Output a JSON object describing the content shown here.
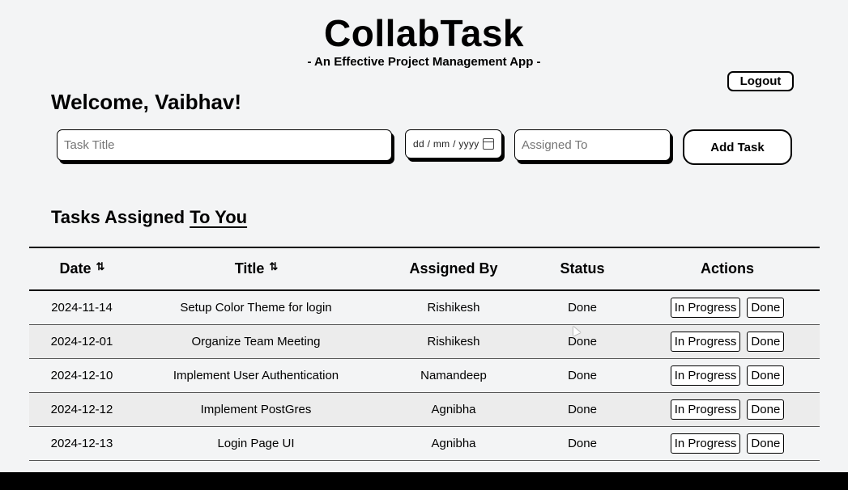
{
  "header": {
    "app_name": "CollabTask",
    "tagline": "- An Effective Project Management App -",
    "logout_label": "Logout"
  },
  "welcome_text": "Welcome, Vaibhav!",
  "form": {
    "title_placeholder": "Task Title",
    "date_placeholder": "dd / mm / yyyy",
    "assignee_placeholder": "Assigned To",
    "add_label": "Add Task"
  },
  "section": {
    "prefix": "Tasks Assigned ",
    "emphasis": "To You"
  },
  "table": {
    "headers": {
      "date": "Date",
      "title": "Title",
      "assigned_by": "Assigned By",
      "status": "Status",
      "actions": "Actions"
    },
    "sort_icon": "sort-arrows-icon",
    "sort_glyph": "⇅",
    "action_labels": {
      "in_progress": "In Progress",
      "done": "Done"
    },
    "rows": [
      {
        "date": "2024-11-14",
        "title": "Setup Color Theme for login",
        "assigned_by": "Rishikesh",
        "status": "Done"
      },
      {
        "date": "2024-12-01",
        "title": "Organize Team Meeting",
        "assigned_by": "Rishikesh",
        "status": "Done"
      },
      {
        "date": "2024-12-10",
        "title": "Implement User Authentication",
        "assigned_by": "Namandeep",
        "status": "Done"
      },
      {
        "date": "2024-12-12",
        "title": "Implement PostGres",
        "assigned_by": "Agnibha",
        "status": "Done"
      },
      {
        "date": "2024-12-13",
        "title": "Login Page UI",
        "assigned_by": "Agnibha",
        "status": "Done"
      }
    ]
  },
  "colors": {
    "background": "#f3f4f5",
    "text": "#000000",
    "stripe": "#ececec"
  }
}
